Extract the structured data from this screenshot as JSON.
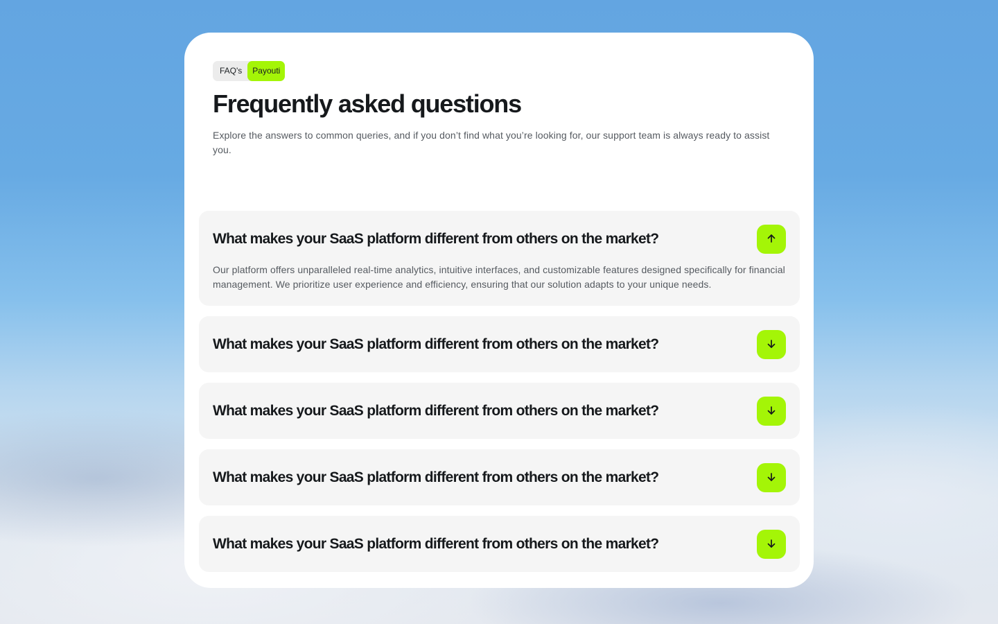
{
  "tags": {
    "primary": "FAQ's",
    "accent": "Payouti"
  },
  "header": {
    "title": "Frequently asked questions",
    "subtitle": "Explore the answers to common queries, and if you don’t find what you’re looking for, our support team is always ready to assist you."
  },
  "faq": {
    "items": [
      {
        "question": "What makes your SaaS platform different from others on the market?",
        "answer": "Our platform offers unparalleled real-time analytics, intuitive interfaces, and customizable features designed specifically for financial management. We prioritize user experience and efficiency, ensuring that our solution adapts to your unique needs.",
        "expanded": true,
        "icon": "arrow-up-icon"
      },
      {
        "question": "What makes your SaaS platform different from others on the market?",
        "expanded": false,
        "icon": "arrow-down-icon"
      },
      {
        "question": "What makes your SaaS platform different from others on the market?",
        "expanded": false,
        "icon": "arrow-down-icon"
      },
      {
        "question": "What makes your SaaS platform different from others on the market?",
        "expanded": false,
        "icon": "arrow-down-icon"
      },
      {
        "question": "What makes your SaaS platform different from others on the market?",
        "expanded": false,
        "icon": "arrow-down-icon"
      }
    ]
  },
  "colors": {
    "accent": "#a4f507",
    "text": "#16191c",
    "muted": "#555a60",
    "item_background": "#f5f5f5"
  }
}
